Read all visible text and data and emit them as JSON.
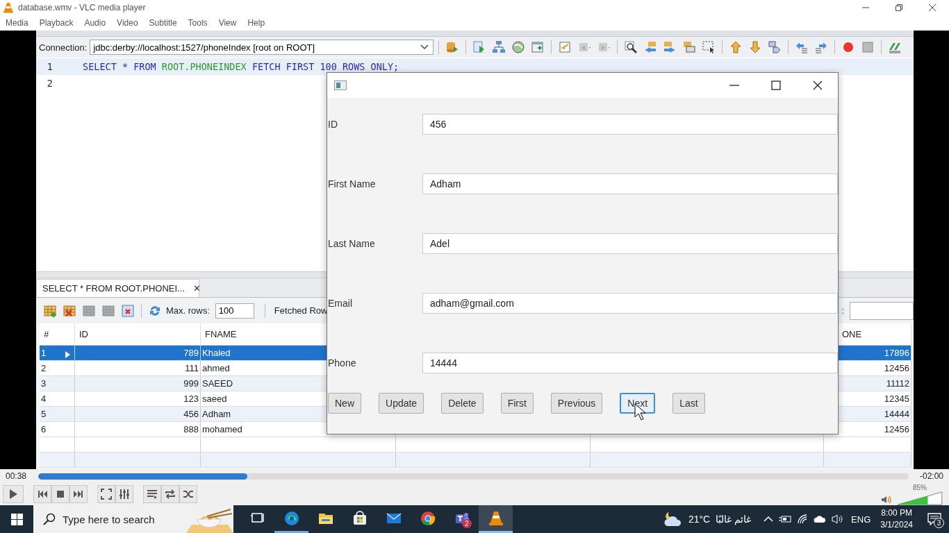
{
  "window": {
    "title": "database.wmv - VLC media player"
  },
  "menu": [
    "Media",
    "Playback",
    "Audio",
    "Video",
    "Subtitle",
    "Tools",
    "View",
    "Help"
  ],
  "ide": {
    "connection": {
      "label": "Connection:",
      "value": "jdbc:derby://localhost:1527/phoneIndex [root on ROOT]"
    },
    "editor": {
      "lines": [
        {
          "number": "1",
          "current": true,
          "code": [
            {
              "kind": "keyword",
              "text": "SELECT * FROM"
            },
            {
              "kind": "identifier",
              "text": "ROOT.PHONEINDEX"
            },
            {
              "kind": "keyword",
              "text": "FETCH FIRST 100 ROWS ONLY;"
            }
          ]
        },
        {
          "number": "2",
          "current": false
        }
      ]
    },
    "results_tab": {
      "label": "SELECT * FROM ROOT.PHONEI...",
      "close": "✕"
    },
    "results_toolbar": {
      "max_rows_label": "Max. rows:",
      "max_rows": "100",
      "fetched_label": "Fetched Row",
      "filter_label": ":"
    },
    "table": {
      "columns": [
        "#",
        "ID",
        "FNAME",
        "ONE"
      ],
      "rows": [
        {
          "number": "1",
          "id": "789",
          "fname": "Khaled",
          "phone": "17896",
          "selected": true
        },
        {
          "number": "2",
          "id": "111",
          "fname": "ahmed",
          "phone": "12456",
          "selected": false
        },
        {
          "number": "3",
          "id": "999",
          "fname": "SAEED",
          "phone": "11112",
          "selected": false
        },
        {
          "number": "4",
          "id": "123",
          "fname": "saeed",
          "phone": "12345",
          "selected": false
        },
        {
          "number": "5",
          "id": "456",
          "fname": "Adham",
          "phone": "14444",
          "selected": false
        },
        {
          "number": "6",
          "id": "888",
          "fname": "mohamed",
          "phone": "12456",
          "selected": false
        }
      ]
    }
  },
  "dialog": {
    "fields": [
      {
        "label": "ID",
        "value": "456"
      },
      {
        "label": "First Name",
        "value": "Adham"
      },
      {
        "label": "Last Name",
        "value": "Adel"
      },
      {
        "label": "Email",
        "value": "adham@gmail.com"
      },
      {
        "label": "Phone",
        "value": "14444"
      }
    ],
    "buttons": [
      {
        "label": "New",
        "focused": false
      },
      {
        "label": "Update",
        "focused": false
      },
      {
        "label": "Delete",
        "focused": false
      },
      {
        "label": "First",
        "focused": false
      },
      {
        "label": "Previous",
        "focused": false
      },
      {
        "label": "Next",
        "focused": true
      },
      {
        "label": "Last",
        "focused": false
      }
    ]
  },
  "player": {
    "elapsed": "00:38",
    "remaining": "-02:00",
    "level": 0.24,
    "volume": {
      "reading": "85%",
      "level": 0.68
    }
  },
  "taskbar": {
    "search": {
      "placeholder": "Type here to search"
    },
    "apps": [
      {
        "kind": "taskview",
        "running": false,
        "active": false
      },
      {
        "kind": "edge",
        "running": true,
        "active": false
      },
      {
        "kind": "explorer",
        "running": false,
        "active": false
      },
      {
        "kind": "store",
        "running": false,
        "active": false
      },
      {
        "kind": "mail",
        "running": false,
        "active": false
      },
      {
        "kind": "chrome",
        "running": false,
        "active": false
      },
      {
        "kind": "teams",
        "running": false,
        "active": false,
        "badge": "2"
      },
      {
        "kind": "vlc",
        "running": true,
        "active": true
      }
    ],
    "weather": {
      "temperature": "21°C",
      "condition": "غائم غالبًا"
    },
    "language": "ENG",
    "time": "8:00 PM",
    "date": "3/1/2024",
    "notifications": "3"
  }
}
